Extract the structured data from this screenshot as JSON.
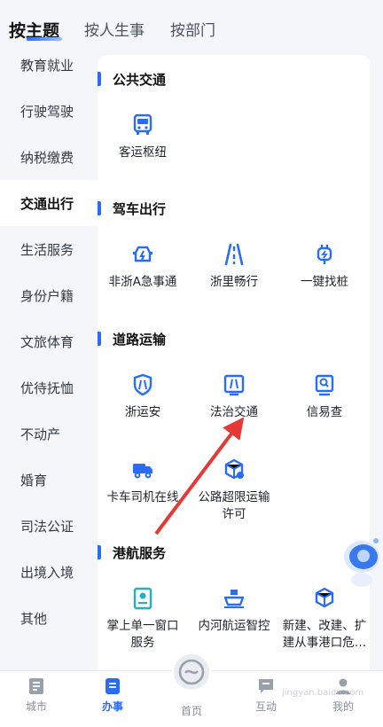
{
  "tabs": [
    {
      "label": "按主题"
    },
    {
      "label": "按人生事"
    },
    {
      "label": "按部门"
    }
  ],
  "sidebar": {
    "items": [
      {
        "label": "教育就业"
      },
      {
        "label": "行驶驾驶"
      },
      {
        "label": "纳税缴费"
      },
      {
        "label": "交通出行"
      },
      {
        "label": "生活服务"
      },
      {
        "label": "身份户籍"
      },
      {
        "label": "文旅体育"
      },
      {
        "label": "优待抚恤"
      },
      {
        "label": "不动产"
      },
      {
        "label": "婚育"
      },
      {
        "label": "司法公证"
      },
      {
        "label": "出境入境"
      },
      {
        "label": "其他"
      }
    ],
    "active": "交通出行"
  },
  "sections": [
    {
      "title": "公共交通",
      "items": [
        {
          "label": "客运枢纽",
          "icon": "bus-icon"
        }
      ]
    },
    {
      "title": "驾车出行",
      "items": [
        {
          "label": "非浙A急事通",
          "icon": "car-alert-icon"
        },
        {
          "label": "浙里畅行",
          "icon": "road-icon"
        },
        {
          "label": "一键找桩",
          "icon": "charger-icon"
        }
      ]
    },
    {
      "title": "道路运输",
      "items": [
        {
          "label": "浙运安",
          "icon": "shield-icon"
        },
        {
          "label": "法治交通",
          "icon": "road-frame-icon"
        },
        {
          "label": "信易查",
          "icon": "search-doc-icon"
        },
        {
          "label": "卡车司机在线",
          "icon": "truck-icon"
        },
        {
          "label": "公路超限运输\n许可",
          "icon": "box-icon"
        }
      ]
    },
    {
      "title": "港航服务",
      "items": [
        {
          "label": "掌上单一窗口\n服务",
          "icon": "id-card-icon"
        },
        {
          "label": "内河航运智控",
          "icon": "ship-icon"
        },
        {
          "label": "新建、改建、扩\n建从事港口危…",
          "icon": "cube-icon"
        }
      ]
    }
  ],
  "bottom_nav": [
    {
      "label": "城市",
      "icon": "city-icon"
    },
    {
      "label": "办事",
      "icon": "service-icon"
    },
    {
      "label": "首页",
      "icon": "home-icon"
    },
    {
      "label": "互动",
      "icon": "chat-icon"
    },
    {
      "label": "我的",
      "icon": "user-icon"
    }
  ],
  "watermark": "jingyan.baidu.com",
  "colors": {
    "accent": "#2a6cf6",
    "annotation_arrow": "#e53935"
  }
}
